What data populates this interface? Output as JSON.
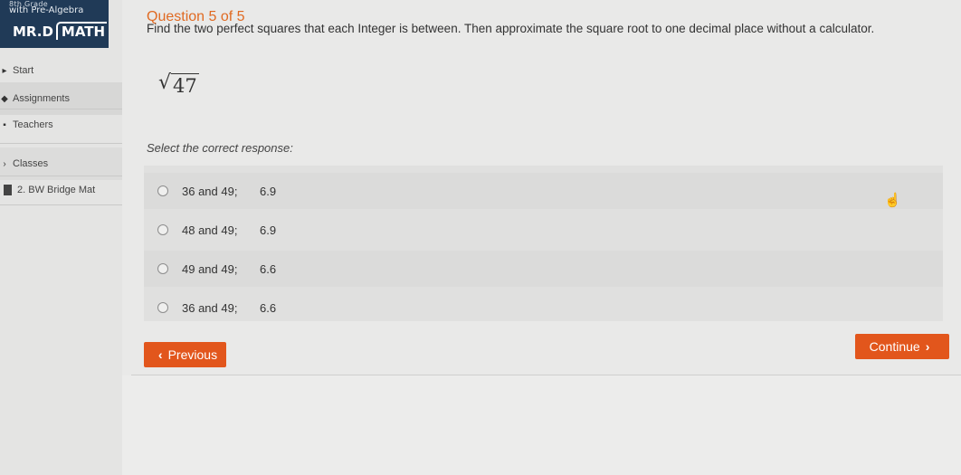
{
  "brand": {
    "top_text": "8th Grade",
    "sub_text": "with Pre-Algebra",
    "logo_left": "MR.D",
    "logo_right": "MATH"
  },
  "sidebar": {
    "items": [
      {
        "label": "Start",
        "icon": "play-icon"
      },
      {
        "label": "Assignments",
        "icon": "assignment-icon"
      },
      {
        "label": "Teachers",
        "icon": "teacher-icon"
      },
      {
        "label": "Classes",
        "icon": "chevron-icon"
      },
      {
        "label": "2. BW Bridge Mat",
        "icon": "class-icon"
      }
    ]
  },
  "question": {
    "header": "Question 5 of 5",
    "prompt": "Find the two perfect squares that each Integer is between. Then approximate the square root to one decimal place without a calculator.",
    "radicand": "47",
    "instruction": "Select the correct response:"
  },
  "choices": [
    {
      "squares": "36 and 49;",
      "approx": "6.9"
    },
    {
      "squares": "48 and 49;",
      "approx": "6.9"
    },
    {
      "squares": "49 and 49;",
      "approx": "6.6"
    },
    {
      "squares": "36 and 49;",
      "approx": "6.6"
    }
  ],
  "buttons": {
    "previous": "Previous",
    "continue": "Continue"
  },
  "colors": {
    "accent": "#e2561c",
    "brand_bg": "#203a57"
  }
}
